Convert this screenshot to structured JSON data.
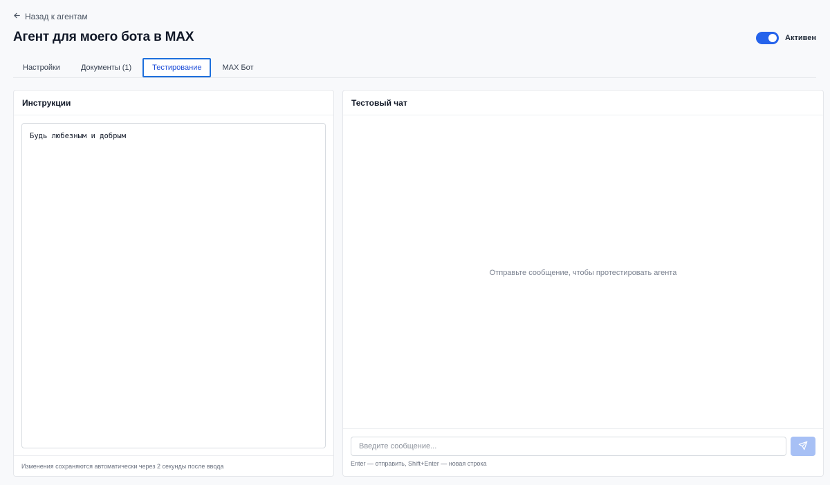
{
  "back_link": {
    "label": "Назад к агентам",
    "icon": "arrow-left-icon"
  },
  "page_title": "Агент для моего бота в MAX",
  "status": {
    "label": "Активен",
    "enabled": true,
    "accent": "#2563eb"
  },
  "tabs": [
    {
      "label": "Настройки",
      "active": false
    },
    {
      "label": "Документы (1)",
      "active": false
    },
    {
      "label": "Тестирование",
      "active": true
    },
    {
      "label": "MAX Бот",
      "active": false
    }
  ],
  "instructions": {
    "title": "Инструкции",
    "text": "Будь любезным и добрым",
    "autosave_note": "Изменения сохраняются автоматически через 2 секунды после ввода"
  },
  "chat": {
    "title": "Тестовый чат",
    "empty_state": "Отправьте сообщение, чтобы протестировать агента",
    "input_placeholder": "Введите сообщение...",
    "hint": "Enter — отправить, Shift+Enter — новая строка",
    "send_icon": "send-icon"
  }
}
